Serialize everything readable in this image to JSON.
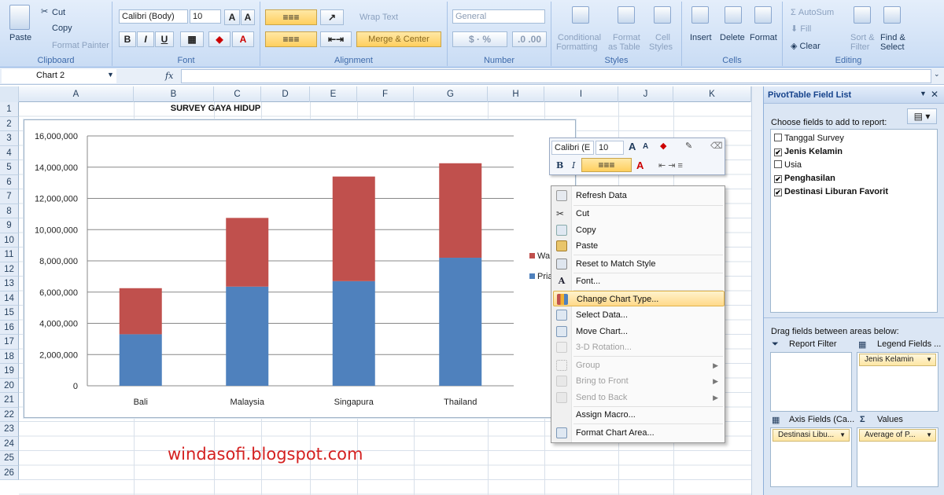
{
  "ribbon": {
    "clipboard": {
      "paste": "Paste",
      "cut": "Cut",
      "copy": "Copy",
      "format_painter": "Format Painter",
      "label": "Clipboard"
    },
    "font": {
      "name": "Calibri (Body)",
      "size": "10",
      "label": "Font"
    },
    "alignment": {
      "wrap": "Wrap Text",
      "merge": "Merge & Center",
      "label": "Alignment"
    },
    "number": {
      "format": "General",
      "label": "Number"
    },
    "styles": {
      "conditional": "Conditional",
      "formatting": "Formatting",
      "format_as": "Format",
      "table": "as Table",
      "cell": "Cell",
      "cell_styles": "Styles",
      "label": "Styles"
    },
    "cells": {
      "insert": "Insert",
      "delete": "Delete",
      "format": "Format",
      "label": "Cells"
    },
    "editing": {
      "autosum": "AutoSum",
      "fill": "Fill",
      "clear": "Clear",
      "sort": "Sort &",
      "filter": "Filter",
      "find": "Find &",
      "select": "Select",
      "label": "Editing"
    }
  },
  "formula_bar": {
    "name_box": "Chart 2",
    "fx": "fx"
  },
  "columns": [
    "A",
    "B",
    "C",
    "D",
    "E",
    "F",
    "G",
    "H",
    "I",
    "J",
    "K"
  ],
  "rows": [
    "1",
    "2",
    "3",
    "4",
    "5",
    "6",
    "7",
    "8",
    "9",
    "10",
    "11",
    "12",
    "13",
    "14",
    "15",
    "16",
    "17",
    "18",
    "19",
    "20",
    "21",
    "22",
    "23",
    "24",
    "25",
    "26"
  ],
  "sheet_title": "SURVEY GAYA HIDUP",
  "chart_data": {
    "type": "bar",
    "stacked": true,
    "categories": [
      "Bali",
      "Malaysia",
      "Singapura",
      "Thailand"
    ],
    "series": [
      {
        "name": "Pria",
        "color": "#4f81bd",
        "values": [
          3300000,
          6350000,
          6700000,
          8200000
        ]
      },
      {
        "name": "Wanita",
        "color": "#c0504d",
        "values": [
          2950000,
          4400000,
          6700000,
          6050000
        ]
      }
    ],
    "ylim": [
      0,
      16000000
    ],
    "yticks": [
      "0",
      "2,000,000",
      "4,000,000",
      "6,000,000",
      "8,000,000",
      "10,000,000",
      "12,000,000",
      "14,000,000",
      "16,000,000"
    ],
    "legend_labels": [
      "Wa",
      "Pria"
    ],
    "grid": true,
    "legend": "right"
  },
  "mini_toolbar": {
    "font": "Calibri (E",
    "size": "10"
  },
  "context_menu": [
    {
      "label": "Refresh Data",
      "enabled": true
    },
    {
      "label": "Cut",
      "enabled": true
    },
    {
      "label": "Copy",
      "enabled": true
    },
    {
      "label": "Paste",
      "enabled": true
    },
    {
      "label": "Reset to Match Style",
      "enabled": true
    },
    {
      "label": "Font...",
      "enabled": true
    },
    {
      "label": "Change Chart Type...",
      "enabled": true,
      "selected": true
    },
    {
      "label": "Select Data...",
      "enabled": true
    },
    {
      "label": "Move Chart...",
      "enabled": true
    },
    {
      "label": "3-D Rotation...",
      "enabled": false
    },
    {
      "label": "Group",
      "enabled": false
    },
    {
      "label": "Bring to Front",
      "enabled": false
    },
    {
      "label": "Send to Back",
      "enabled": false
    },
    {
      "label": "Assign Macro...",
      "enabled": true
    },
    {
      "label": "Format Chart Area...",
      "enabled": true
    }
  ],
  "pivot": {
    "title": "PivotTable Field List",
    "choose": "Choose fields to add to report:",
    "fields": [
      {
        "label": "Tanggal Survey",
        "checked": false
      },
      {
        "label": "Jenis Kelamin",
        "checked": true
      },
      {
        "label": "Usia",
        "checked": false
      },
      {
        "label": "Penghasilan",
        "checked": true
      },
      {
        "label": "Destinasi Liburan Favorit",
        "checked": true
      }
    ],
    "drag": "Drag fields between areas below:",
    "report_filter": "Report Filter",
    "legend_fields": "Legend Fields ...",
    "legend_chip": "Jenis Kelamin",
    "axis_fields": "Axis Fields (Ca...",
    "values": "Values",
    "axis_chip": "Destinasi Libu...",
    "values_chip": "Average of P..."
  },
  "watermark": "windasofi.blogspot.com"
}
